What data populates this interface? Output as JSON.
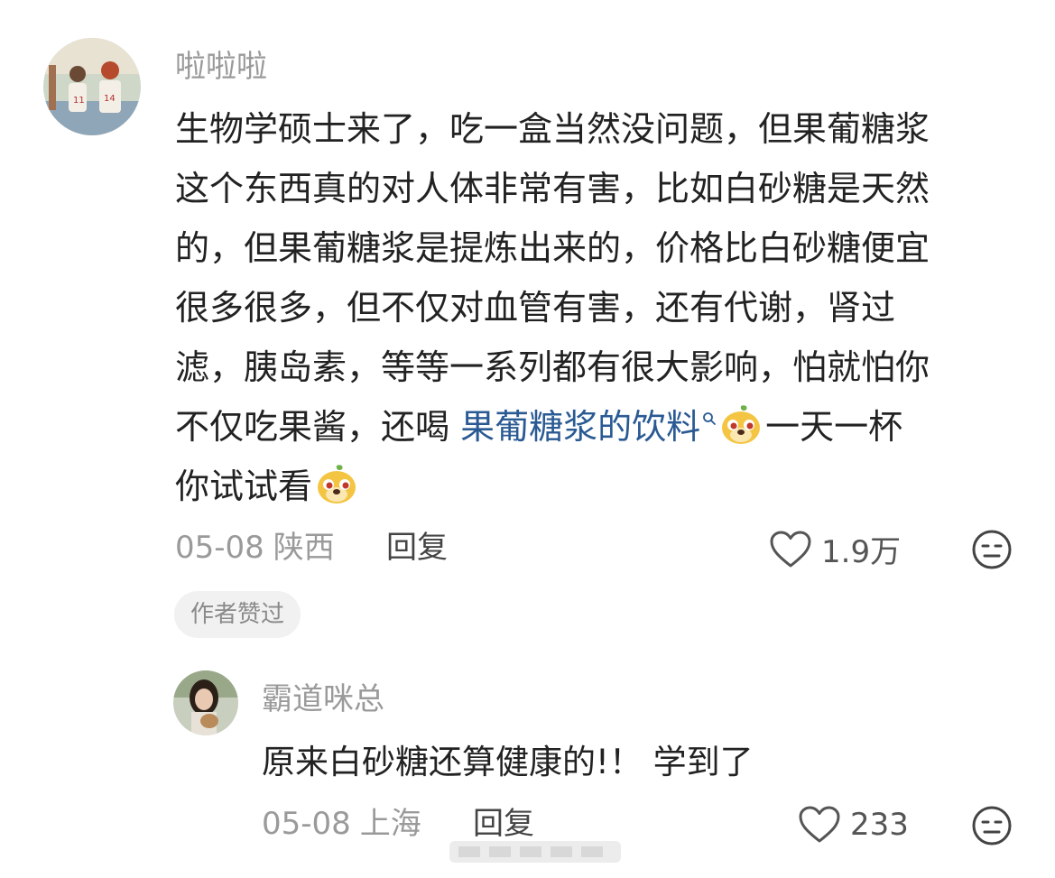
{
  "comment": {
    "username": "啦啦啦",
    "text_lines": [
      "生物学硕士来了，吃一盒当然没问题，但果葡糖浆",
      "这个东西真的对人体非常有害，比如白砂糖是天然",
      "的，但果葡糖浆是提炼出来的，价格比白砂糖便宜",
      "很多很多，但不仅对血管有害，还有代谢，肾过",
      "滤，胰岛素，等等一系列都有很大影响，怕就怕你"
    ],
    "line6_prefix": "不仅吃果酱，还喝 ",
    "topic_link": "果葡糖浆的饮料",
    "line6_suffix": "一天一杯",
    "line7_text": "你试试看",
    "date": "05-08",
    "location": "陕西",
    "reply_label": "回复",
    "like_count": "1.9万",
    "author_badge": "作者赞过"
  },
  "reply": {
    "username": "霸道咪总",
    "text": "原来白砂糖还算健康的!！ 学到了",
    "date": "05-08",
    "location": "上海",
    "reply_label": "回复",
    "like_count": "233"
  },
  "icons": {
    "like": "heart-outline-icon",
    "more": "meh-face-icon",
    "emoji": "doge-emoji-icon",
    "search": "search-icon"
  },
  "colors": {
    "username": "#9a9a9a",
    "text": "#222222",
    "link": "#2a5a93",
    "meta": "#9a9a9a",
    "badge_bg": "#f1f1f1"
  }
}
